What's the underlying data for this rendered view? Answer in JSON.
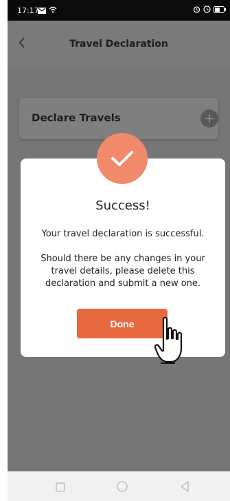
{
  "status_bar": {
    "time": "17:17",
    "icons": [
      "mail-icon",
      "wifi-icon",
      "alarm-icon",
      "clock-icon",
      "battery-icon"
    ]
  },
  "header": {
    "back_icon": "chevron-left-icon",
    "title": "Travel Declaration"
  },
  "declare_card": {
    "label": "Declare Travels",
    "add_icon": "plus-icon"
  },
  "modal": {
    "icon": "check-icon",
    "title": "Success!",
    "message": "Your travel declaration is successful.",
    "note": "Should there be any changes in your travel details, please delete this declaration and submit a new one.",
    "done_label": "Done"
  },
  "nav_bar": {
    "icons": [
      "recent-apps-icon",
      "home-icon",
      "back-icon"
    ]
  },
  "colors": {
    "accent": "#e8693f",
    "check_circle": "#f08a6a",
    "overlay": "#767676"
  }
}
